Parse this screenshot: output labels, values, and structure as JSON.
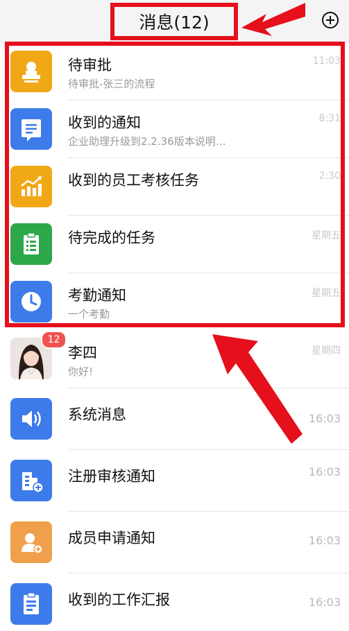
{
  "header": {
    "title": "消息(12)",
    "add_icon": "plus-circle-icon"
  },
  "messages": [
    {
      "title": "待审批",
      "subtitle": "待审批-张三的流程",
      "time": "11:03",
      "icon": "stamp-icon",
      "color": "#f0a817"
    },
    {
      "title": "收到的通知",
      "subtitle": "企业助理升级到2.2.36版本说明…",
      "time": "8:31",
      "icon": "notice-icon",
      "color": "#3d7bea"
    },
    {
      "title": "收到的员工考核任务",
      "subtitle": "",
      "time": "2:30",
      "icon": "chart-icon",
      "color": "#f0a817"
    },
    {
      "title": "待完成的任务",
      "subtitle": "",
      "time": "星期五",
      "icon": "checklist-icon",
      "color": "#2ca84a"
    },
    {
      "title": "考勤通知",
      "subtitle": "一个考勤",
      "time": "星期五",
      "icon": "clock-icon",
      "color": "#3d7bea"
    },
    {
      "title": "李四",
      "subtitle": "你好!",
      "time": "星期四",
      "icon": "avatar",
      "badge": "12"
    },
    {
      "title": "系统消息",
      "subtitle": "",
      "time": "16:03",
      "icon": "speaker-icon",
      "color": "#3d7bea"
    },
    {
      "title": "注册审核通知",
      "subtitle": "",
      "time": "16:03",
      "icon": "building-add-icon",
      "color": "#3d7bea"
    },
    {
      "title": "成员申请通知",
      "subtitle": "",
      "time": "16:03",
      "icon": "user-add-icon",
      "color": "#f0a04b"
    },
    {
      "title": "收到的工作汇报",
      "subtitle": "",
      "time": "16:03",
      "icon": "report-icon",
      "color": "#3d7bea"
    }
  ],
  "annotation_color": "#e5101c"
}
